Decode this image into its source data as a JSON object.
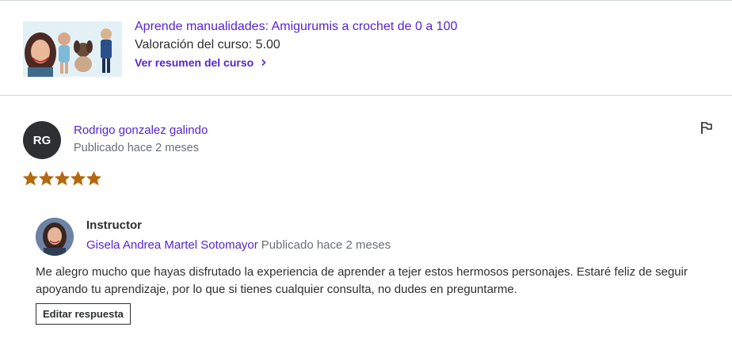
{
  "course": {
    "title": "Aprende manualidades: Amigurumis a crochet de 0 a 100",
    "rating_text": "Valoración del curso: 5.00",
    "summary_link": "Ver resumen del curso",
    "chevron_icon": "chevron-right-icon"
  },
  "review": {
    "avatar_initials": "RG",
    "reviewer_name": "Rodrigo gonzalez galindo",
    "posted": "Publicado hace 2 meses",
    "rating": 5,
    "rating_max": 5,
    "star_color": "#b4690e",
    "flag_icon": "flag-icon"
  },
  "instructor_response": {
    "label": "Instructor",
    "name": "Gisela Andrea Martel Sotomayor",
    "posted": "Publicado hace 2 meses",
    "text": "Me alegro mucho que hayas disfrutado la experiencia de aprender a tejer estos hermosos personajes. Estaré feliz de seguir apoyando tu aprendizaje, por lo que si tienes cualquier consulta, no dudes en preguntarme.",
    "edit_button": "Editar respuesta"
  },
  "colors": {
    "accent": "#5624d0",
    "text": "#2d2f31",
    "muted": "#6a6f73",
    "border": "#d1d7dc"
  }
}
